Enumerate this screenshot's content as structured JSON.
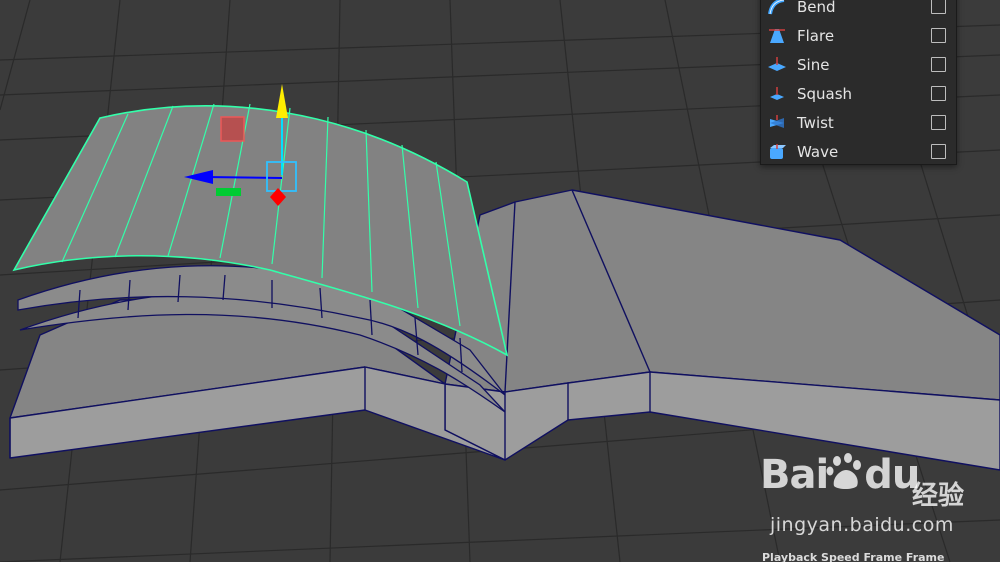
{
  "deformer_menu": {
    "items": [
      {
        "label": "Bend",
        "icon": "bend-icon",
        "checked": false
      },
      {
        "label": "Flare",
        "icon": "flare-icon",
        "checked": false
      },
      {
        "label": "Sine",
        "icon": "sine-icon",
        "checked": false
      },
      {
        "label": "Squash",
        "icon": "squash-icon",
        "checked": false
      },
      {
        "label": "Twist",
        "icon": "twist-icon",
        "checked": false
      },
      {
        "label": "Wave",
        "icon": "wave-icon",
        "checked": false
      }
    ]
  },
  "watermark": {
    "brand": "Bai",
    "brand_suffix": "du",
    "cn": "经验",
    "url": "jingyan.baidu.com"
  },
  "status": {
    "text": "Playback Speed        Frame Frame"
  },
  "colors": {
    "viewport_bg": "#3b3b3b",
    "grid": "#2a2a2a",
    "mesh_face": "#848484",
    "mesh_side": "#9a9a9a",
    "mesh_edge": "#101060",
    "selection": "#33ffaa",
    "menu_bg": "#2b2b2b",
    "manip_y": "#ffee00",
    "manip_x": "#0000ff",
    "manip_z": "#00cc33",
    "manip_center": "#ff0000"
  }
}
